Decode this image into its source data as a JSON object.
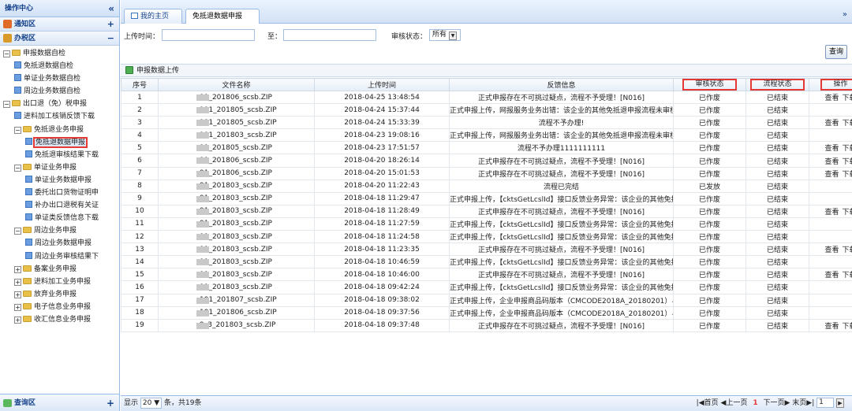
{
  "left_panel": {
    "title": "操作中心",
    "collapse_glyph": "«",
    "sections": [
      {
        "label": "通知区",
        "control": "+",
        "icon": "bird-icon"
      },
      {
        "label": "办税区",
        "control": "−",
        "icon": "book-icon"
      }
    ],
    "tree": [
      {
        "label": "申报数据自检",
        "level": 0,
        "type": "folder",
        "toggle": "−"
      },
      {
        "label": "免抵退数据自检",
        "level": 1,
        "type": "page"
      },
      {
        "label": "单证业务数据自检",
        "level": 1,
        "type": "page"
      },
      {
        "label": "周边业务数据自检",
        "level": 1,
        "type": "page"
      },
      {
        "label": "出口退（免）税申报",
        "level": 0,
        "type": "folder",
        "toggle": "−"
      },
      {
        "label": "进料加工核销反馈下载",
        "level": 1,
        "type": "page"
      },
      {
        "label": "免抵退业务申报",
        "level": 1,
        "type": "folder",
        "toggle": "−"
      },
      {
        "label": "免抵退数据申报",
        "level": 2,
        "type": "page",
        "selected": true
      },
      {
        "label": "免抵退审核结果下载",
        "level": 2,
        "type": "page"
      },
      {
        "label": "单证业务申报",
        "level": 1,
        "type": "folder",
        "toggle": "−"
      },
      {
        "label": "单证业务数据申报",
        "level": 2,
        "type": "page"
      },
      {
        "label": "委托出口货物证明申",
        "level": 2,
        "type": "page"
      },
      {
        "label": "补办出口退税有关证",
        "level": 2,
        "type": "page"
      },
      {
        "label": "单证类反馈信息下载",
        "level": 2,
        "type": "page"
      },
      {
        "label": "周边业务申报",
        "level": 1,
        "type": "folder",
        "toggle": "−"
      },
      {
        "label": "周边业务数据申报",
        "level": 2,
        "type": "page"
      },
      {
        "label": "周边业务审核结果下",
        "level": 2,
        "type": "page"
      },
      {
        "label": "备案业务申报",
        "level": 1,
        "type": "folder",
        "toggle": "+"
      },
      {
        "label": "进料加工业务申报",
        "level": 1,
        "type": "folder",
        "toggle": "+"
      },
      {
        "label": "放弃业务申报",
        "level": 1,
        "type": "folder",
        "toggle": "+"
      },
      {
        "label": "电子信息业务申报",
        "level": 1,
        "type": "folder",
        "toggle": "+"
      },
      {
        "label": "收汇信息业务申报",
        "level": 1,
        "type": "folder",
        "toggle": "+"
      }
    ],
    "footer": {
      "label": "查询区",
      "control": "+"
    }
  },
  "tabs": {
    "items": [
      {
        "label": "我的主页",
        "active": false
      },
      {
        "label": "免抵退数据申报",
        "active": true,
        "close": "×"
      }
    ],
    "more_glyph": "»"
  },
  "search": {
    "upload_time_label": "上传时间：",
    "to_label": "至：",
    "status_label": "审核状态：",
    "status_value": "所有",
    "query_button": "查询"
  },
  "grid": {
    "toolbar_label": "申报数据上传",
    "columns": [
      "序号",
      "文件名称",
      "上传时间",
      "反馈信息",
      "审核状态",
      "流程状态",
      "操作"
    ],
    "rows": [
      {
        "no": "1",
        "file": "91_201806_scsb.ZIP",
        "time": "2018-04-25 13:48:54",
        "msg": "正式申报存在不可挑过疑点，流程不予受理！[N016]",
        "audit": "已作废",
        "flow": "已结束",
        "ops": [
          "查看",
          "下载"
        ]
      },
      {
        "no": "2",
        "file": "191_201805_scsb.ZIP",
        "time": "2018-04-24 15:37:44",
        "msg": "正式申报上传，网报服务业务出错：该企业的其他免抵退申报流程未审核",
        "audit": "已作废",
        "flow": "已结束",
        "ops": []
      },
      {
        "no": "3",
        "file": "191_201805_scsb.ZIP",
        "time": "2018-04-24 15:33:39",
        "msg": "流程不予办理!",
        "audit": "已作废",
        "flow": "已结束",
        "ops": [
          "查看",
          "下载"
        ]
      },
      {
        "no": "4",
        "file": "191_201803_scsb.ZIP",
        "time": "2018-04-23 19:08:16",
        "msg": "正式申报上传，网报服务业务出错：该企业的其他免抵退申报流程未审核",
        "audit": "已作废",
        "flow": "已结束",
        "ops": []
      },
      {
        "no": "5",
        "file": "91_201805_scsb.ZIP",
        "time": "2018-04-23 17:51:57",
        "msg": "流程不予办理1111111111",
        "audit": "已作废",
        "flow": "已结束",
        "ops": [
          "查看",
          "下载"
        ]
      },
      {
        "no": "6",
        "file": "91_201806_scsb.ZIP",
        "time": "2018-04-20 18:26:14",
        "msg": "正式申报存在不可挑过疑点，流程不予受理！[N016]",
        "audit": "已作废",
        "flow": "已结束",
        "ops": [
          "查看",
          "下载"
        ]
      },
      {
        "no": "7",
        "file": "91_201806_scsb.ZIP",
        "time": "2018-04-20 15:01:53",
        "msg": "正式申报存在不可挑过疑点，流程不予受理！[N016]",
        "audit": "已作废",
        "flow": "已结束",
        "ops": [
          "查看",
          "下载"
        ]
      },
      {
        "no": "8",
        "file": "91_201803_scsb.ZIP",
        "time": "2018-04-20 11:22:43",
        "msg": "流程已完结",
        "audit": "已发放",
        "flow": "已结束",
        "ops": []
      },
      {
        "no": "9",
        "file": "91_201803_scsb.ZIP",
        "time": "2018-04-18 11:29:47",
        "msg": "正式申报上传，【cktsGetLcslId】接口反馈业务异常：该企业的其他免抵",
        "audit": "已作废",
        "flow": "已结束",
        "ops": []
      },
      {
        "no": "10",
        "file": "91_201803_scsb.ZIP",
        "time": "2018-04-18 11:28:49",
        "msg": "正式申报存在不可挑过疑点，流程不予受理！[N016]",
        "audit": "已作废",
        "flow": "已结束",
        "ops": [
          "查看",
          "下载"
        ]
      },
      {
        "no": "11",
        "file": "91_201803_scsb.ZIP",
        "time": "2018-04-18 11:27:59",
        "msg": "正式申报上传，【cktsGetLcslId】接口反馈业务异常：该企业的其他免抵",
        "audit": "已作废",
        "flow": "已结束",
        "ops": []
      },
      {
        "no": "12",
        "file": "91_201803_scsb.ZIP",
        "time": "2018-04-18 11:24:58",
        "msg": "正式申报上传，【cktsGetLcslId】接口反馈业务异常：该企业的其他免抵",
        "audit": "已作废",
        "flow": "已结束",
        "ops": []
      },
      {
        "no": "13",
        "file": "91_201803_scsb.ZIP",
        "time": "2018-04-18 11:23:35",
        "msg": "正式申报存在不可挑过疑点，流程不予受理！[N016]",
        "audit": "已作废",
        "flow": "已结束",
        "ops": [
          "查看",
          "下载"
        ]
      },
      {
        "no": "14",
        "file": "91_201803_scsb.ZIP",
        "time": "2018-04-18 10:46:59",
        "msg": "正式申报上传，【cktsGetLcslId】接口反馈业务异常：该企业的其他免抵",
        "audit": "已作废",
        "flow": "已结束",
        "ops": []
      },
      {
        "no": "15",
        "file": "91_201803_scsb.ZIP",
        "time": "2018-04-18 10:46:00",
        "msg": "正式申报存在不可挑过疑点，流程不予受理！[N016]",
        "audit": "已作废",
        "flow": "已结束",
        "ops": [
          "查看",
          "下载"
        ]
      },
      {
        "no": "16",
        "file": "91_201803_scsb.ZIP",
        "time": "2018-04-18 09:42:24",
        "msg": "正式申报上传，【cktsGetLcslId】接口反馈业务异常：该企业的其他免抵",
        "audit": "已作废",
        "flow": "已结束",
        "ops": []
      },
      {
        "no": "17",
        "file": "191_201807_scsb.ZIP",
        "time": "2018-04-18 09:38:02",
        "msg": "正式申报上传，企业申报商品码版本（CMCODE2018A_20180201）与",
        "audit": "已作废",
        "flow": "已结束",
        "ops": []
      },
      {
        "no": "18",
        "file": "191_201806_scsb.ZIP",
        "time": "2018-04-18 09:37:56",
        "msg": "正式申报上传，企业申报商品码版本（CMCODE2018A_20180201）与",
        "audit": "已作废",
        "flow": "已结束",
        "ops": []
      },
      {
        "no": "19",
        "file": "9_3_201803_scsb.ZIP",
        "time": "2018-04-18 09:37:48",
        "msg": "正式申报存在不可挑过疑点，流程不予受理！[N016]",
        "audit": "已作废",
        "flow": "已结束",
        "ops": [
          "查看",
          "下载"
        ]
      }
    ]
  },
  "pager": {
    "show_label": "显示",
    "page_size": "20",
    "summary": "条，共19条",
    "first": "首页",
    "prev": "上一页",
    "current_page": "1",
    "next": "下一页",
    "last": "末页",
    "page_input": "1"
  },
  "colors": {
    "border_blue": "#99bbe8",
    "header_text": "#15428b",
    "highlight_red": "#e53935"
  }
}
